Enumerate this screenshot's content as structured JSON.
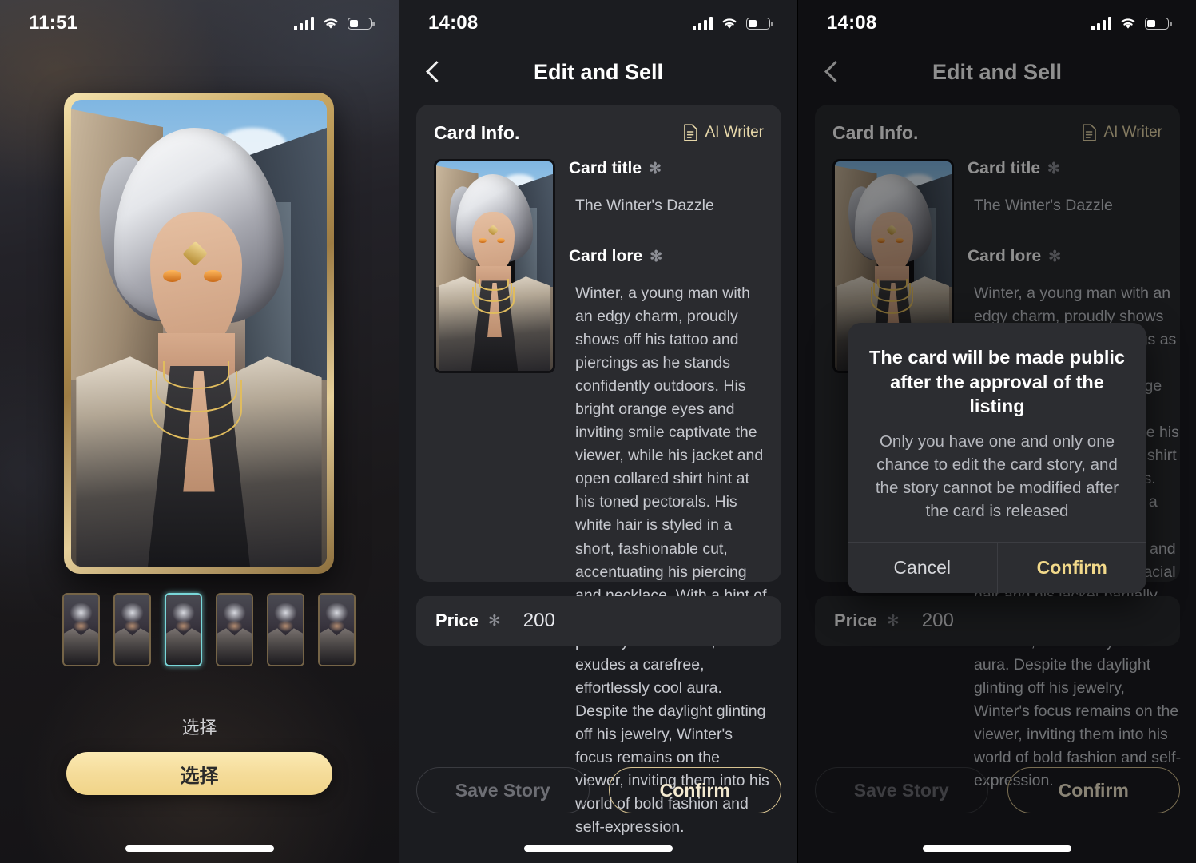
{
  "screens": [
    {
      "id": "card-picker",
      "status": {
        "time": "11:51",
        "signal_icon": "cellular-signal-icon",
        "wifi_icon": "wifi-icon",
        "battery_icon": "battery-icon"
      },
      "picker": {
        "hint_label": "选择",
        "select_button": "选择",
        "thumbnail_count": 6,
        "selected_thumbnail_index": 3,
        "selected_border_color": "#79d7d9",
        "frame_color": "#caa964"
      }
    },
    {
      "id": "edit-and-sell",
      "status": {
        "time": "14:08",
        "signal_icon": "cellular-signal-icon",
        "wifi_icon": "wifi-icon",
        "battery_icon": "battery-icon"
      },
      "nav": {
        "back_icon": "chevron-left-icon",
        "title": "Edit and Sell"
      },
      "card_info": {
        "section_title": "Card Info.",
        "ai_writer_label": "AI Writer",
        "ai_writer_icon": "document-text-icon",
        "ai_writer_color": "#e6d7a9",
        "fields": {
          "title_label": "Card title",
          "title_required_mark": "✻",
          "title_value": "The Winter's Dazzle",
          "lore_label": "Card lore",
          "lore_required_mark": "✻",
          "lore_value": "Winter, a young man with an edgy charm, proudly shows off his tattoo and piercings as he stands confidently outdoors. His bright orange eyes and inviting smile captivate the viewer, while his jacket and open collared shirt hint at his toned pectorals. His white hair is styled in a short, fashionable cut, accentuating his piercing and necklace. With a hint of facial hair and his jacket partially unbuttoned, Winter exudes a carefree, effortlessly cool aura. Despite the daylight glinting off his jewelry, Winter's focus remains on the viewer, inviting them into his world of bold fashion and self-expression."
        }
      },
      "price": {
        "label": "Price",
        "required_mark": "✻",
        "value": "200"
      },
      "actions": {
        "save_label": "Save Story",
        "confirm_label": "Confirm"
      }
    },
    {
      "id": "edit-and-sell-confirm-dialog",
      "status": {
        "time": "14:08",
        "signal_icon": "cellular-signal-icon",
        "wifi_icon": "wifi-icon",
        "battery_icon": "battery-icon"
      },
      "nav": {
        "back_icon": "chevron-left-icon",
        "title": "Edit and Sell"
      },
      "card_info": {
        "section_title": "Card Info.",
        "ai_writer_label": "AI Writer",
        "ai_writer_icon": "document-text-icon",
        "fields": {
          "title_label": "Card title",
          "title_required_mark": "✻",
          "title_value": "The Winter's Dazzle",
          "lore_label": "Card lore",
          "lore_required_mark": "✻",
          "lore_value": "Winter, a young man with an edgy charm, proudly shows off his tattoo and piercings as he stands confidently outdoors. His bright orange eyes and inviting smile captivate the viewer, while his jacket and open collared shirt hint at his toned pectorals. His white hair is styled in a short, fashionable cut, accentuating his piercing and necklace. With a hint of facial hair and his jacket partially unbuttoned, Winter exudes a carefree, effortlessly cool aura. Despite the daylight glinting off his jewelry, Winter's focus remains on the viewer, inviting them into his world of bold fashion and self-expression."
        }
      },
      "price": {
        "label": "Price",
        "required_mark": "✻",
        "value": "200"
      },
      "actions": {
        "save_label": "Save Story",
        "confirm_label": "Confirm"
      },
      "dialog": {
        "title": "The card will be made public after the approval of the listing",
        "message": "Only you have one and only one chance to edit the card story, and the story cannot be modified after the card is released",
        "cancel_label": "Cancel",
        "confirm_label": "Confirm",
        "confirm_color": "#f2d98a"
      }
    }
  ]
}
